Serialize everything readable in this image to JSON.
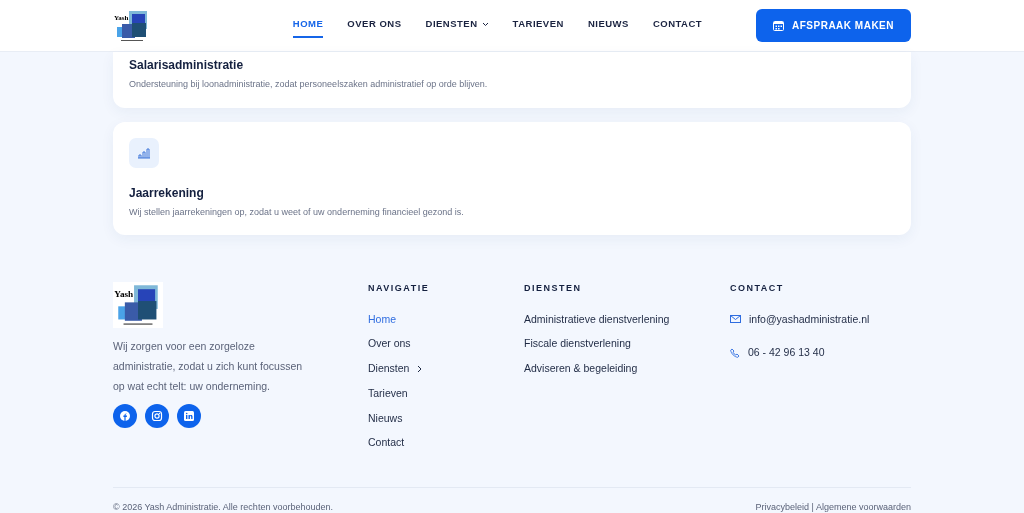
{
  "header": {
    "logo_text": "Yash",
    "nav": [
      {
        "label": "HOME",
        "selected": true,
        "dropdown": false
      },
      {
        "label": "OVER ONS",
        "selected": false,
        "dropdown": false
      },
      {
        "label": "DIENSTEN",
        "selected": false,
        "dropdown": true
      },
      {
        "label": "TARIEVEN",
        "selected": false,
        "dropdown": false
      },
      {
        "label": "NIEUWS",
        "selected": false,
        "dropdown": false
      },
      {
        "label": "CONTACT",
        "selected": false,
        "dropdown": false
      }
    ],
    "cta": "AFSPRAAK MAKEN"
  },
  "services": [
    {
      "title": "Salarisadministratie",
      "text": "Ondersteuning bij loonadministratie, zodat personeelszaken administratief op orde blijven.",
      "icon": false
    },
    {
      "title": "Jaarrekening",
      "text": "Wij stellen jaarrekeningen op, zodat u weet of uw onderneming financieel gezond is.",
      "icon": true
    }
  ],
  "footer": {
    "logo_text": "Yash",
    "about": "Wij zorgen voor een zorgeloze administratie, zodat u zich kunt focussen op wat echt telt: uw onderneming.",
    "socials": [
      {
        "kind": "facebook"
      },
      {
        "kind": "instagram"
      },
      {
        "kind": "linkedin"
      }
    ],
    "navigation": {
      "heading": "NAVIGATIE",
      "items": [
        {
          "label": "Home",
          "selected": true,
          "submenu": false
        },
        {
          "label": "Over ons",
          "selected": false,
          "submenu": false
        },
        {
          "label": "Diensten",
          "selected": false,
          "submenu": true
        },
        {
          "label": "Tarieven",
          "selected": false,
          "submenu": false
        },
        {
          "label": "Nieuws",
          "selected": false,
          "submenu": false
        },
        {
          "label": "Contact",
          "selected": false,
          "submenu": false
        }
      ]
    },
    "services": {
      "heading": "DIENSTEN",
      "items": [
        "Administratieve dienstverlening",
        "Fiscale dienstverlening",
        "Adviseren & begeleiding"
      ]
    },
    "contact": {
      "heading": "CONTACT",
      "items": [
        {
          "kind": "email",
          "text": "info@yashadministratie.nl"
        },
        {
          "kind": "phone",
          "text": "06 - 42 96 13 40"
        }
      ]
    },
    "copyright": "© 2026 Yash Administratie. Alle rechten voorbehouden.",
    "legal": "Privacybeleid | Algemene voorwaarden"
  }
}
